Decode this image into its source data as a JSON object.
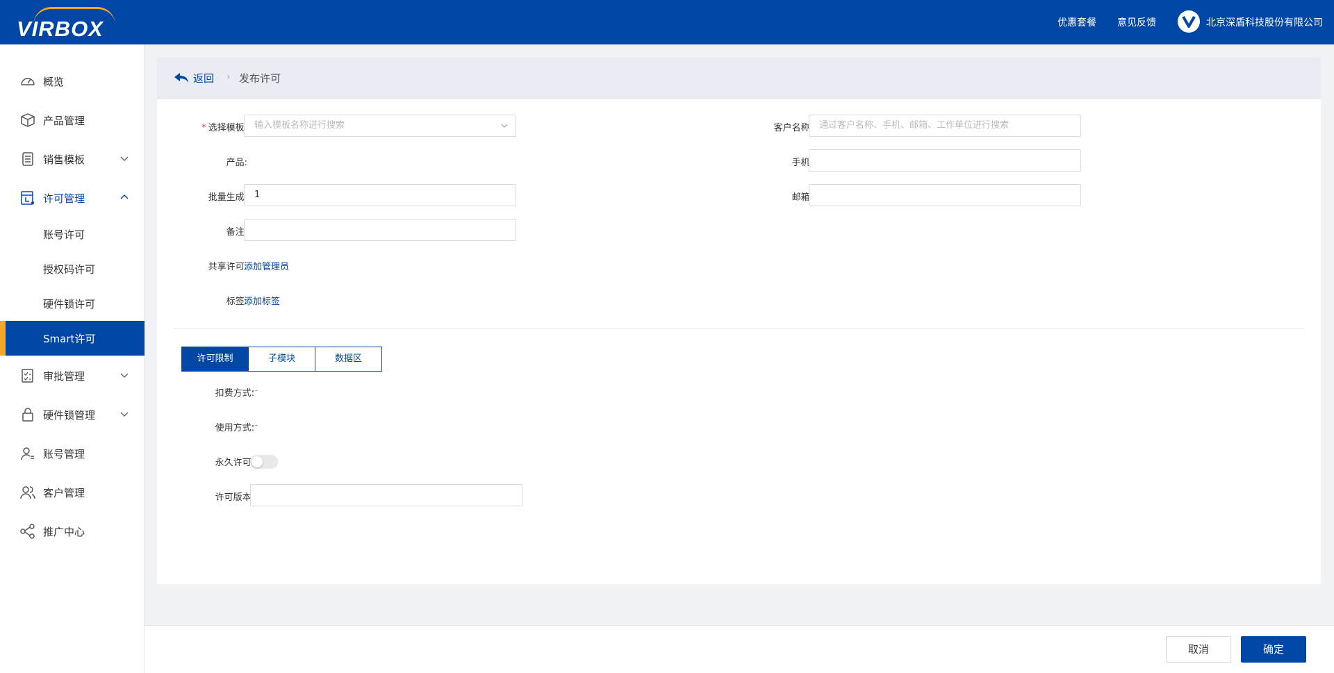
{
  "header": {
    "logo_text": "VIRBOX",
    "links": [
      "优惠套餐",
      "意见反馈"
    ],
    "company": "北京深盾科技股份有限公司"
  },
  "sidebar": {
    "items": [
      {
        "label": "概览",
        "icon": "dashboard-icon"
      },
      {
        "label": "产品管理",
        "icon": "box-icon"
      },
      {
        "label": "销售模板",
        "icon": "template-icon",
        "expandable": true
      },
      {
        "label": "许可管理",
        "icon": "license-icon",
        "expanded": true
      },
      {
        "label": "审批管理",
        "icon": "approval-icon",
        "expandable": true
      },
      {
        "label": "硬件锁管理",
        "icon": "lock-icon",
        "expandable": true
      },
      {
        "label": "账号管理",
        "icon": "user-icon"
      },
      {
        "label": "客户管理",
        "icon": "customers-icon"
      },
      {
        "label": "推广中心",
        "icon": "share-icon"
      }
    ],
    "sub_items": [
      "账号许可",
      "授权码许可",
      "硬件锁许可",
      "Smart许可"
    ],
    "selected_sub": "Smart许可"
  },
  "breadcrumb": {
    "back": "返回",
    "current": "发布许可"
  },
  "form": {
    "template_label": "选择模板:",
    "template_placeholder": "输入模板名称进行搜索",
    "product_label": "产品:",
    "batch_label": "批量生成:",
    "batch_value": "1",
    "remark_label": "备注:",
    "remark_value": "",
    "share_label": "共享许可:",
    "share_link": "添加管理员",
    "tag_label": "标签:",
    "tag_link": "添加标签",
    "customer_label": "客户名称:",
    "customer_placeholder": "通过客户名称、手机、邮箱、工作单位进行搜索",
    "phone_label": "手机:",
    "phone_value": "",
    "email_label": "邮箱:",
    "email_value": ""
  },
  "tabs": [
    {
      "label": "许可限制",
      "active": true
    },
    {
      "label": "子模块",
      "active": false
    },
    {
      "label": "数据区",
      "active": false
    }
  ],
  "limits": {
    "charge_label": "扣费方式:",
    "charge_value": "--",
    "usage_label": "使用方式:",
    "usage_value": "--",
    "permanent_label": "永久许可:",
    "permanent_on": false,
    "version_label": "许可版本:",
    "version_value": ""
  },
  "footer": {
    "cancel": "取消",
    "confirm": "确定"
  },
  "colors": {
    "brand": "#0046a5",
    "accent": "#f5a623",
    "required": "#e53935"
  }
}
